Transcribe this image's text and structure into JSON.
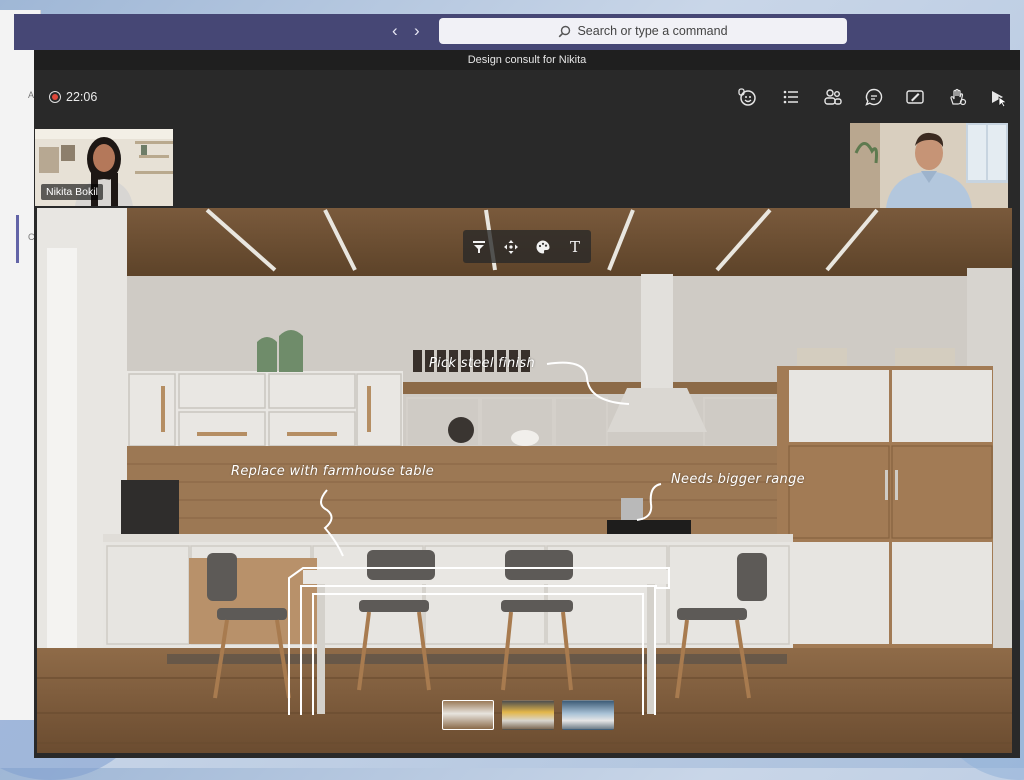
{
  "teams_bar": {
    "back_icon": "chevron-left-icon",
    "forward_icon": "chevron-right-icon",
    "search_placeholder": "Search or type a command"
  },
  "meeting": {
    "title": "Design consult for Nikita",
    "recording_time": "22:06",
    "controls": [
      {
        "name": "reactions",
        "icon": "reactions-icon"
      },
      {
        "name": "agenda-list",
        "icon": "list-icon"
      },
      {
        "name": "participants",
        "icon": "people-icon"
      },
      {
        "name": "chat",
        "icon": "chat-icon"
      },
      {
        "name": "whiteboard",
        "icon": "whiteboard-icon"
      },
      {
        "name": "raise-hand",
        "icon": "hand-icon"
      },
      {
        "name": "share",
        "icon": "share-icon"
      }
    ],
    "participants": [
      {
        "name": "Nikita Bokil"
      },
      {
        "name": ""
      }
    ]
  },
  "stage": {
    "annotations": [
      {
        "text": "Pick steel finish"
      },
      {
        "text": "Replace with farmhouse table"
      },
      {
        "text": "Needs bigger range"
      }
    ],
    "toolbar": [
      {
        "name": "filter",
        "icon": "filter-icon"
      },
      {
        "name": "move",
        "icon": "move-icon"
      },
      {
        "name": "palette",
        "icon": "palette-icon"
      },
      {
        "name": "text",
        "icon": "text-icon",
        "glyph": "T"
      }
    ],
    "scenes": [
      {
        "name": "kitchen-wood",
        "active": true
      },
      {
        "name": "kitchen-yellow",
        "active": false
      },
      {
        "name": "kitchen-blue",
        "active": false
      }
    ]
  },
  "colors": {
    "teams_purple": "#464775",
    "meeting_bg": "#292929",
    "record_red": "#e0483a",
    "accent": "#6264a7"
  }
}
